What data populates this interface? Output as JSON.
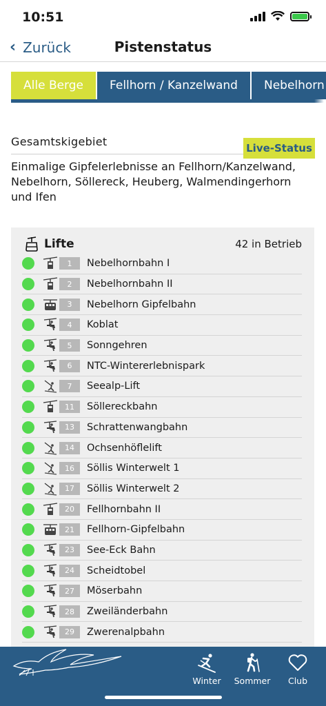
{
  "status": {
    "time": "10:51"
  },
  "nav": {
    "back_label": "Zurück",
    "title": "Pistenstatus"
  },
  "tabs": [
    {
      "label": "Alle Berge",
      "active": true
    },
    {
      "label": "Fellhorn / Kanzelwand",
      "active": false
    },
    {
      "label": "Nebelhorn",
      "active": false
    }
  ],
  "area": {
    "title": "Gesamtskigebiet",
    "badge": "Live-Status",
    "description": "Einmalige Gipfelerlebnisse an Fellhorn/Kanzelwand, Nebelhorn, Söllereck, Heuberg, Walmendingerhorn und Ifen"
  },
  "lifts": {
    "title": "Lifte",
    "count": "42 in Betrieb",
    "status_color": "#53d94e",
    "items": [
      {
        "number": "1",
        "name": "Nebelhornbahn I",
        "icon": "aerial-tramway-icon"
      },
      {
        "number": "2",
        "name": "Nebelhornbahn II",
        "icon": "aerial-tramway-icon"
      },
      {
        "number": "3",
        "name": "Nebelhorn Gipfelbahn",
        "icon": "gondola-icon"
      },
      {
        "number": "4",
        "name": "Koblat",
        "icon": "chairlift-icon"
      },
      {
        "number": "5",
        "name": "Sonngehren",
        "icon": "chairlift-icon"
      },
      {
        "number": "6",
        "name": "NTC-Wintererlebnispark",
        "icon": "chairlift-icon"
      },
      {
        "number": "7",
        "name": "Seealp-Lift",
        "icon": "surface-lift-icon"
      },
      {
        "number": "11",
        "name": "Söllereckbahn",
        "icon": "aerial-tramway-icon"
      },
      {
        "number": "13",
        "name": "Schrattenwangbahn",
        "icon": "chairlift-icon"
      },
      {
        "number": "14",
        "name": "Ochsenhöflelift",
        "icon": "surface-lift-icon"
      },
      {
        "number": "16",
        "name": "Söllis Winterwelt 1",
        "icon": "surface-lift-icon"
      },
      {
        "number": "17",
        "name": "Söllis Winterwelt 2",
        "icon": "surface-lift-icon"
      },
      {
        "number": "20",
        "name": "Fellhornbahn II",
        "icon": "aerial-tramway-icon"
      },
      {
        "number": "21",
        "name": "Fellhorn-Gipfelbahn",
        "icon": "gondola-icon"
      },
      {
        "number": "23",
        "name": "See-Eck Bahn",
        "icon": "chairlift-icon"
      },
      {
        "number": "24",
        "name": "Scheidtobel",
        "icon": "chairlift-icon"
      },
      {
        "number": "27",
        "name": "Möserbahn",
        "icon": "chairlift-icon"
      },
      {
        "number": "28",
        "name": "Zweiländerbahn",
        "icon": "chairlift-icon"
      },
      {
        "number": "29",
        "name": "Zwerenalpbahn",
        "icon": "chairlift-icon"
      }
    ]
  },
  "bottom_tabs": [
    {
      "label": "Winter",
      "icon": "skier-icon"
    },
    {
      "label": "Sommer",
      "icon": "hiker-icon"
    },
    {
      "label": "Club",
      "icon": "heart-icon"
    }
  ],
  "colors": {
    "brand_blue": "#2a5c86",
    "accent_yellow": "#d6df3b"
  }
}
